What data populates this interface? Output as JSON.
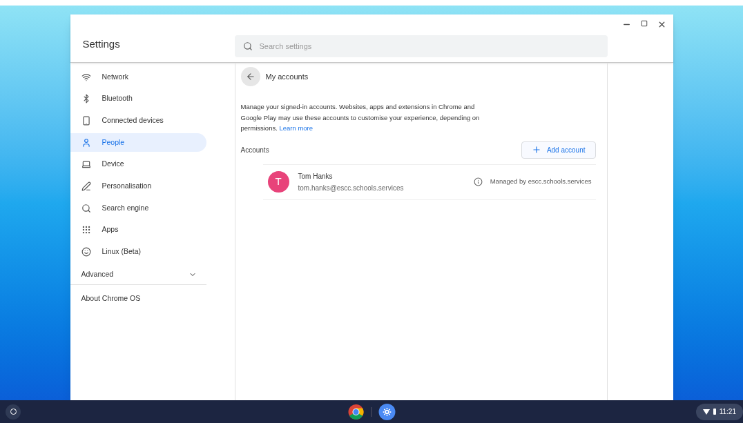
{
  "window": {
    "title": "Settings",
    "controls": [
      {
        "kind": "minimize"
      },
      {
        "kind": "maximize"
      },
      {
        "kind": "close"
      }
    ]
  },
  "search": {
    "placeholder": "Search settings"
  },
  "sidebar": {
    "items": [
      {
        "kind": "wifi",
        "label": "Network",
        "selected": false
      },
      {
        "kind": "bluetooth",
        "label": "Bluetooth",
        "selected": false
      },
      {
        "kind": "phone",
        "label": "Connected devices",
        "selected": false
      },
      {
        "kind": "person",
        "label": "People",
        "selected": true
      },
      {
        "kind": "laptop",
        "label": "Device",
        "selected": false
      },
      {
        "kind": "brush",
        "label": "Personalisation",
        "selected": false
      },
      {
        "kind": "search",
        "label": "Search engine",
        "selected": false
      },
      {
        "kind": "grid",
        "label": "Apps",
        "selected": false
      },
      {
        "kind": "linux",
        "label": "Linux (Beta)",
        "selected": false
      }
    ],
    "advanced": {
      "label": "Advanced",
      "expanded": false
    },
    "about": "About Chrome OS"
  },
  "page": {
    "title": "My accounts",
    "description": "Manage your signed-in accounts. Websites, apps and extensions in Chrome and Google Play may use these accounts to customise your experience, depending on permissions.",
    "learn_more": "Learn more",
    "accounts_label": "Accounts",
    "add_button": "Add account",
    "accounts": [
      {
        "initial": "T",
        "color": "#e8437a",
        "name": "Tom Hanks",
        "email": "tom.hanks@escc.schools.services",
        "managed": "Managed by escc.schools.services"
      }
    ]
  },
  "taskbar": {
    "apps": [
      {
        "kind": "chrome"
      },
      {
        "kind": "settings"
      }
    ],
    "time": "11:21"
  }
}
